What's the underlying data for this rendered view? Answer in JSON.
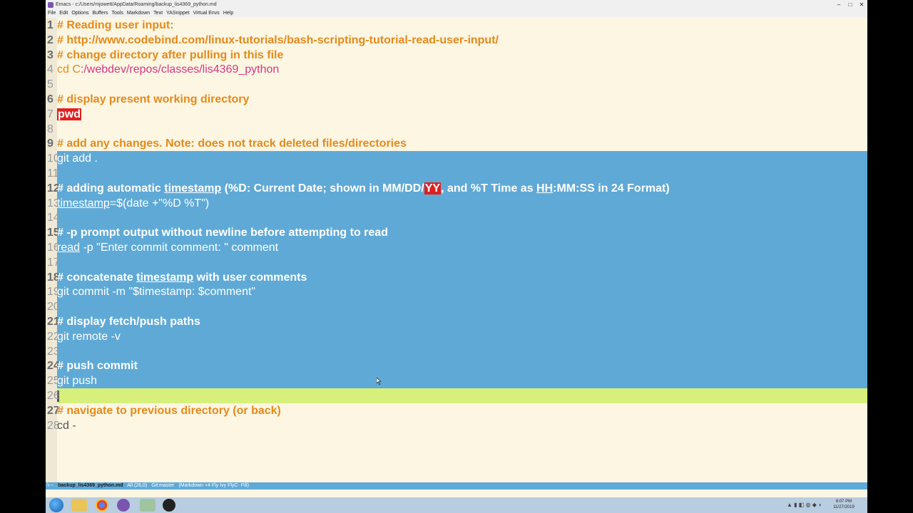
{
  "window": {
    "title": "Emacs - c:/Users/mjowett/AppData/Roaming/backup_lis4369_python.md",
    "controls": [
      "–",
      "□",
      "✕"
    ]
  },
  "menu": [
    "File",
    "Edit",
    "Options",
    "Buffers",
    "Tools",
    "Markdown",
    "Text",
    "YASnippet",
    "Virtual Envs",
    "Help"
  ],
  "lines": [
    {
      "n": "1",
      "parts": [
        {
          "t": "# Reading user input:",
          "k": "c"
        }
      ]
    },
    {
      "n": "2",
      "parts": [
        {
          "t": "# http://www.codebind.com/linux-tutorials/bash-scripting-tutorial-read-user-input/",
          "k": "c"
        }
      ]
    },
    {
      "n": "3",
      "parts": [
        {
          "t": "# change directory after pulling in this file",
          "k": "c"
        }
      ]
    },
    {
      "n": "4",
      "parts": [
        {
          "t": "cd",
          "k": "cd"
        },
        {
          "t": " C",
          "k": "cd"
        },
        {
          "t": ":/webdev/repos/classes/lis4369_python",
          "k": "pink"
        }
      ]
    },
    {
      "n": "5",
      "parts": []
    },
    {
      "n": "6",
      "parts": [
        {
          "t": "# display present working directory",
          "k": "c"
        }
      ]
    },
    {
      "n": "7",
      "parts": [
        {
          "t": "pwd",
          "k": "tag"
        }
      ]
    },
    {
      "n": "8",
      "parts": []
    },
    {
      "n": "9",
      "parts": [
        {
          "t": "# add any changes. Note: does not track deleted files/directories",
          "k": "c"
        }
      ]
    },
    {
      "n": "10",
      "parts": [
        {
          "t": "git add .",
          "k": "pl"
        }
      ]
    },
    {
      "n": "11",
      "parts": []
    },
    {
      "n": "12",
      "parts": [
        {
          "t": "# adding automatic ",
          "k": "c"
        },
        {
          "t": "timestamp",
          "k": "cu"
        },
        {
          "t": " (%D: Current Date; shown in MM/DD/",
          "k": "c"
        },
        {
          "t": "YY",
          "k": "tag"
        },
        {
          "t": ", and %T Time as ",
          "k": "c"
        },
        {
          "t": "HH",
          "k": "cu"
        },
        {
          "t": ":MM:SS in 24 Format)",
          "k": "c"
        }
      ]
    },
    {
      "n": "13",
      "parts": [
        {
          "t": "timestamp",
          "k": "plu"
        },
        {
          "t": "=$(date +\"%D %T\")",
          "k": "pl"
        }
      ]
    },
    {
      "n": "14",
      "parts": []
    },
    {
      "n": "15",
      "parts": [
        {
          "t": "# -p prompt output without newline before attempting to read",
          "k": "c"
        }
      ]
    },
    {
      "n": "16",
      "parts": [
        {
          "t": "read",
          "k": "plu"
        },
        {
          "t": " -p \"Enter commit comment: \" comment",
          "k": "pl"
        }
      ]
    },
    {
      "n": "17",
      "parts": []
    },
    {
      "n": "18",
      "parts": [
        {
          "t": "# concatenate ",
          "k": "c"
        },
        {
          "t": "timestamp",
          "k": "cu"
        },
        {
          "t": " with user comments",
          "k": "c"
        }
      ]
    },
    {
      "n": "19",
      "parts": [
        {
          "t": "git commit -m \"$timestamp: $comment\"",
          "k": "pl"
        }
      ]
    },
    {
      "n": "20",
      "parts": []
    },
    {
      "n": "21",
      "parts": [
        {
          "t": "# display fetch/push paths",
          "k": "c"
        }
      ]
    },
    {
      "n": "22",
      "parts": [
        {
          "t": "git remote -v",
          "k": "pl"
        }
      ]
    },
    {
      "n": "23",
      "parts": []
    },
    {
      "n": "24",
      "parts": [
        {
          "t": "# push commit",
          "k": "c"
        }
      ]
    },
    {
      "n": "25",
      "parts": [
        {
          "t": "git push",
          "k": "pl"
        }
      ]
    },
    {
      "n": "26",
      "parts": []
    },
    {
      "n": "27",
      "parts": [
        {
          "t": "# navigate to previous directory (or back)",
          "k": "c"
        }
      ]
    },
    {
      "n": "28",
      "parts": [
        {
          "t": "cd -",
          "k": "pl"
        }
      ]
    }
  ],
  "modeline": {
    "flags": "-\\---",
    "buffer": "backup_lis4369_python.md",
    "position": "All (26,0)",
    "vc": "Git:master",
    "modes": "(Markdown +4 Fly Ivy FlyC- Fill)"
  },
  "taskbar": {
    "time": "6:07 PM",
    "date": "11/27/2019",
    "apps": [
      "explorer-icon",
      "chrome-icon",
      "emacs-icon",
      "app-icon",
      "obs-icon"
    ]
  },
  "colors": {
    "comment": "#e58a1b",
    "selection": "#5fa9d6",
    "current_line": "#d6f07b",
    "background": "#fdf6e3",
    "error_tag": "#e02020"
  }
}
